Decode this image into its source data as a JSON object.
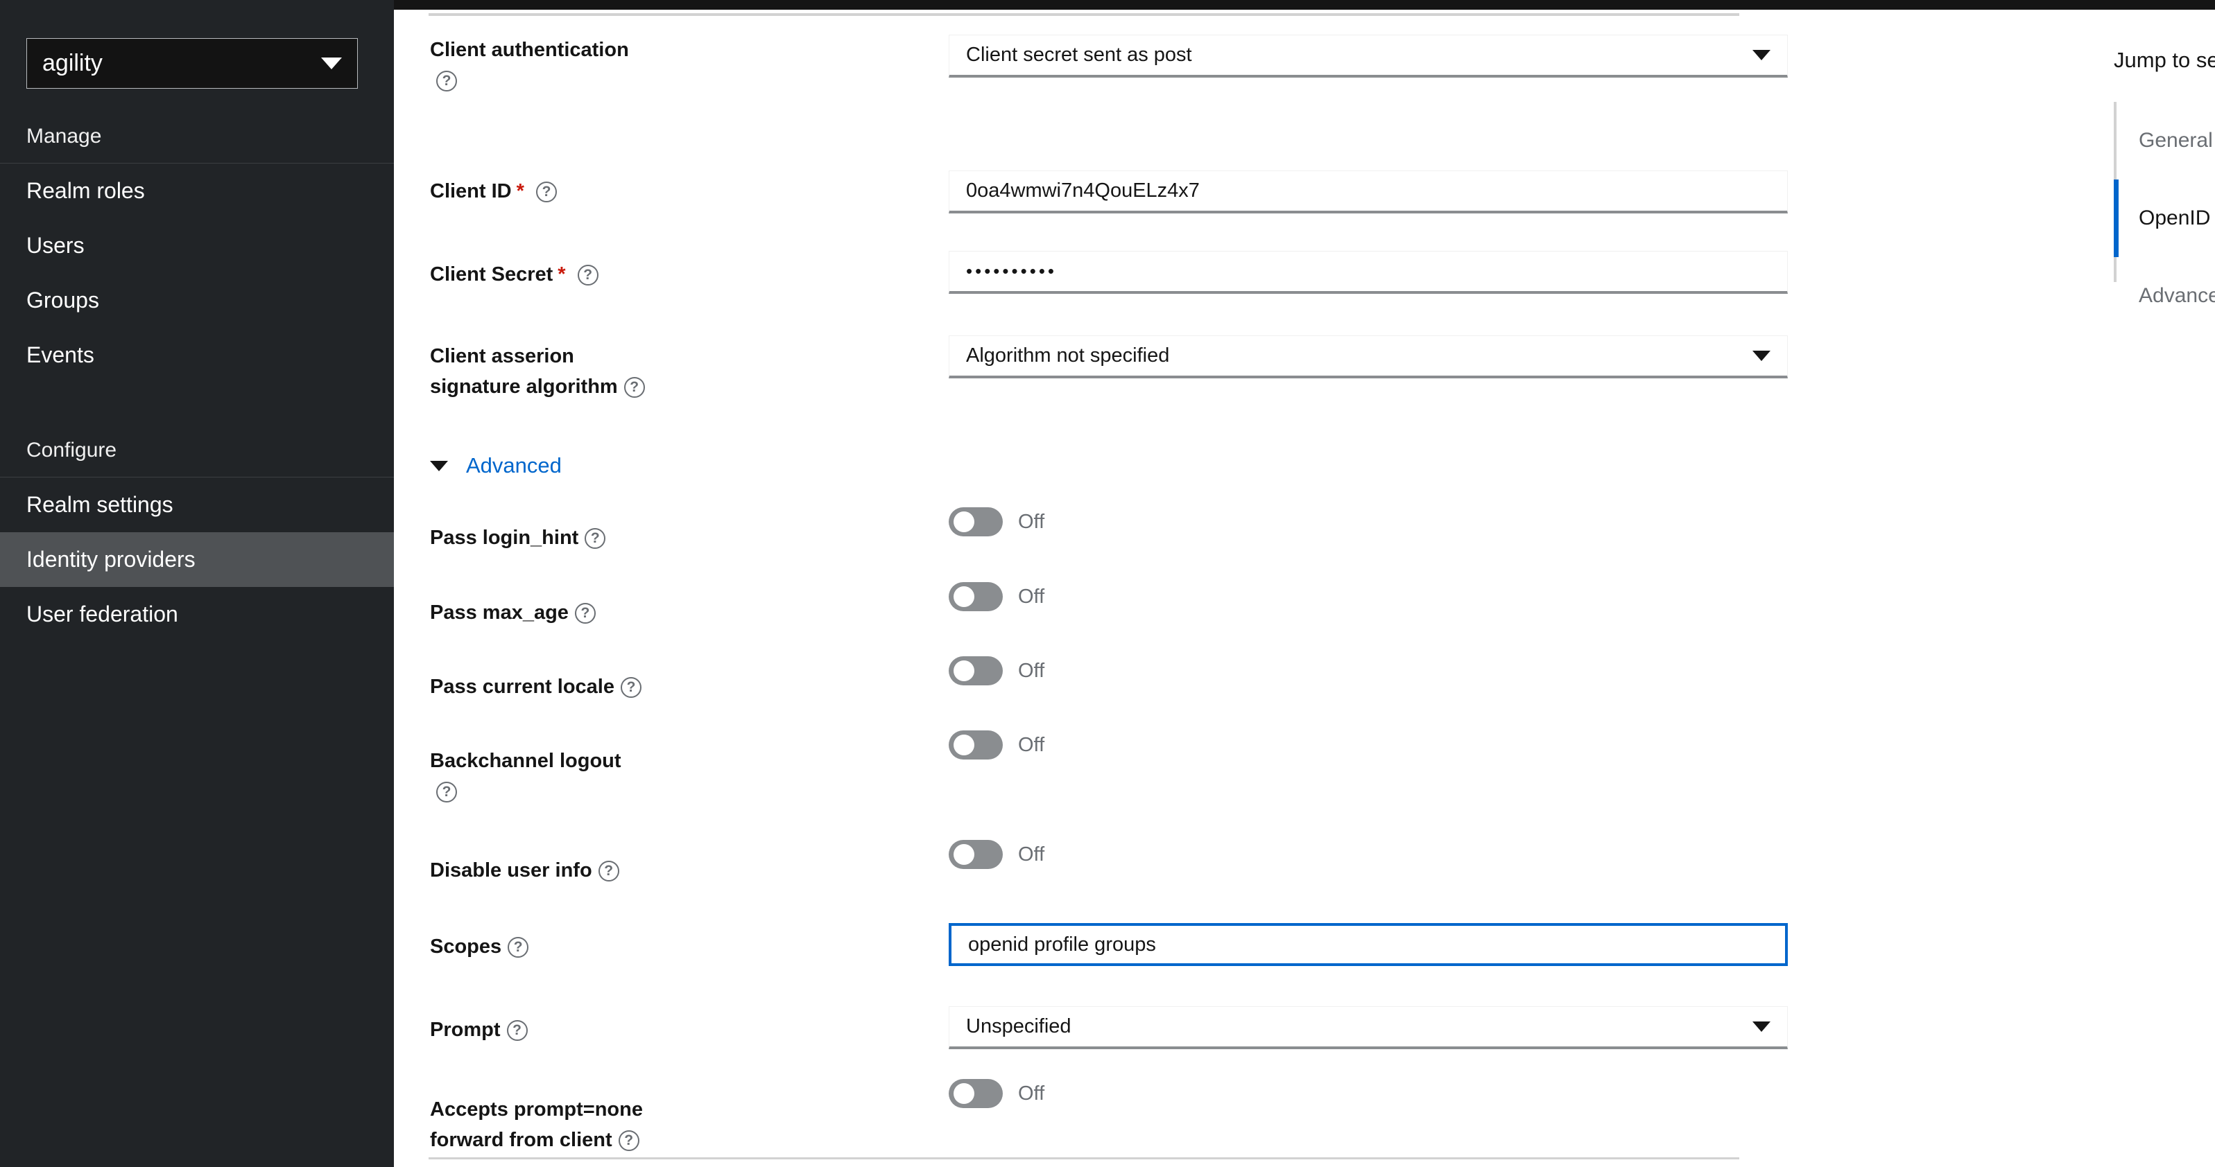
{
  "sidebar": {
    "realm_selector": {
      "value": "agility",
      "icon": "chevron-down-icon"
    },
    "sections": [
      {
        "heading": "Manage",
        "items": [
          {
            "label": "Realm roles",
            "active": false
          },
          {
            "label": "Users",
            "active": false
          },
          {
            "label": "Groups",
            "active": false
          },
          {
            "label": "Events",
            "active": false
          }
        ]
      },
      {
        "heading": "Configure",
        "items": [
          {
            "label": "Realm settings",
            "active": false
          },
          {
            "label": "Identity providers",
            "active": true
          },
          {
            "label": "User federation",
            "active": false
          }
        ]
      }
    ]
  },
  "form": {
    "fields": [
      {
        "label": "Client authentication",
        "type": "select",
        "value": "Client secret sent as post",
        "required": false,
        "help": true,
        "label_wraps": true
      },
      {
        "label": "Client ID",
        "type": "text",
        "value": "0oa4wmwi7n4QouELz4x7",
        "required": true,
        "help": true
      },
      {
        "label": "Client Secret",
        "type": "password",
        "value": "••••••••••",
        "required": true,
        "help": true
      },
      {
        "label": "Client asserion signature algorithm",
        "type": "select",
        "value": "Algorithm not specified",
        "required": false,
        "help": true,
        "label_wraps": true
      }
    ],
    "advanced_section": {
      "label": "Advanced",
      "expanded": true,
      "icon": "chevron-down-icon"
    },
    "toggles": [
      {
        "label": "Pass login_hint",
        "state": "Off",
        "on": false,
        "help": true
      },
      {
        "label": "Pass max_age",
        "state": "Off",
        "on": false,
        "help": true
      },
      {
        "label": "Pass current locale",
        "state": "Off",
        "on": false,
        "help": true
      },
      {
        "label": "Backchannel logout",
        "state": "Off",
        "on": false,
        "help": true
      },
      {
        "label": "Disable user info",
        "state": "Off",
        "on": false,
        "help": true
      }
    ],
    "scopes": {
      "label": "Scopes",
      "value": "openid profile groups",
      "focused": true,
      "help": true
    },
    "prompt": {
      "label": "Prompt",
      "value": "Unspecified",
      "help": true
    },
    "accepts_prompt_none": {
      "label": "Accepts prompt=none forward from client",
      "state": "Off",
      "on": false,
      "help": true
    }
  },
  "jump_to_section": {
    "title": "Jump to section",
    "items": [
      {
        "label": "General settings",
        "active": false
      },
      {
        "label": "OpenID Connect settings",
        "active": true
      },
      {
        "label": "Advanced settings",
        "active": false
      }
    ]
  },
  "colors": {
    "sidebar_bg": "#212427",
    "sidebar_active": "#4f5255",
    "accent_blue": "#06c",
    "required_red": "#c9190b",
    "toggle_off": "#8a8d90",
    "muted_text": "#6a6e73"
  }
}
